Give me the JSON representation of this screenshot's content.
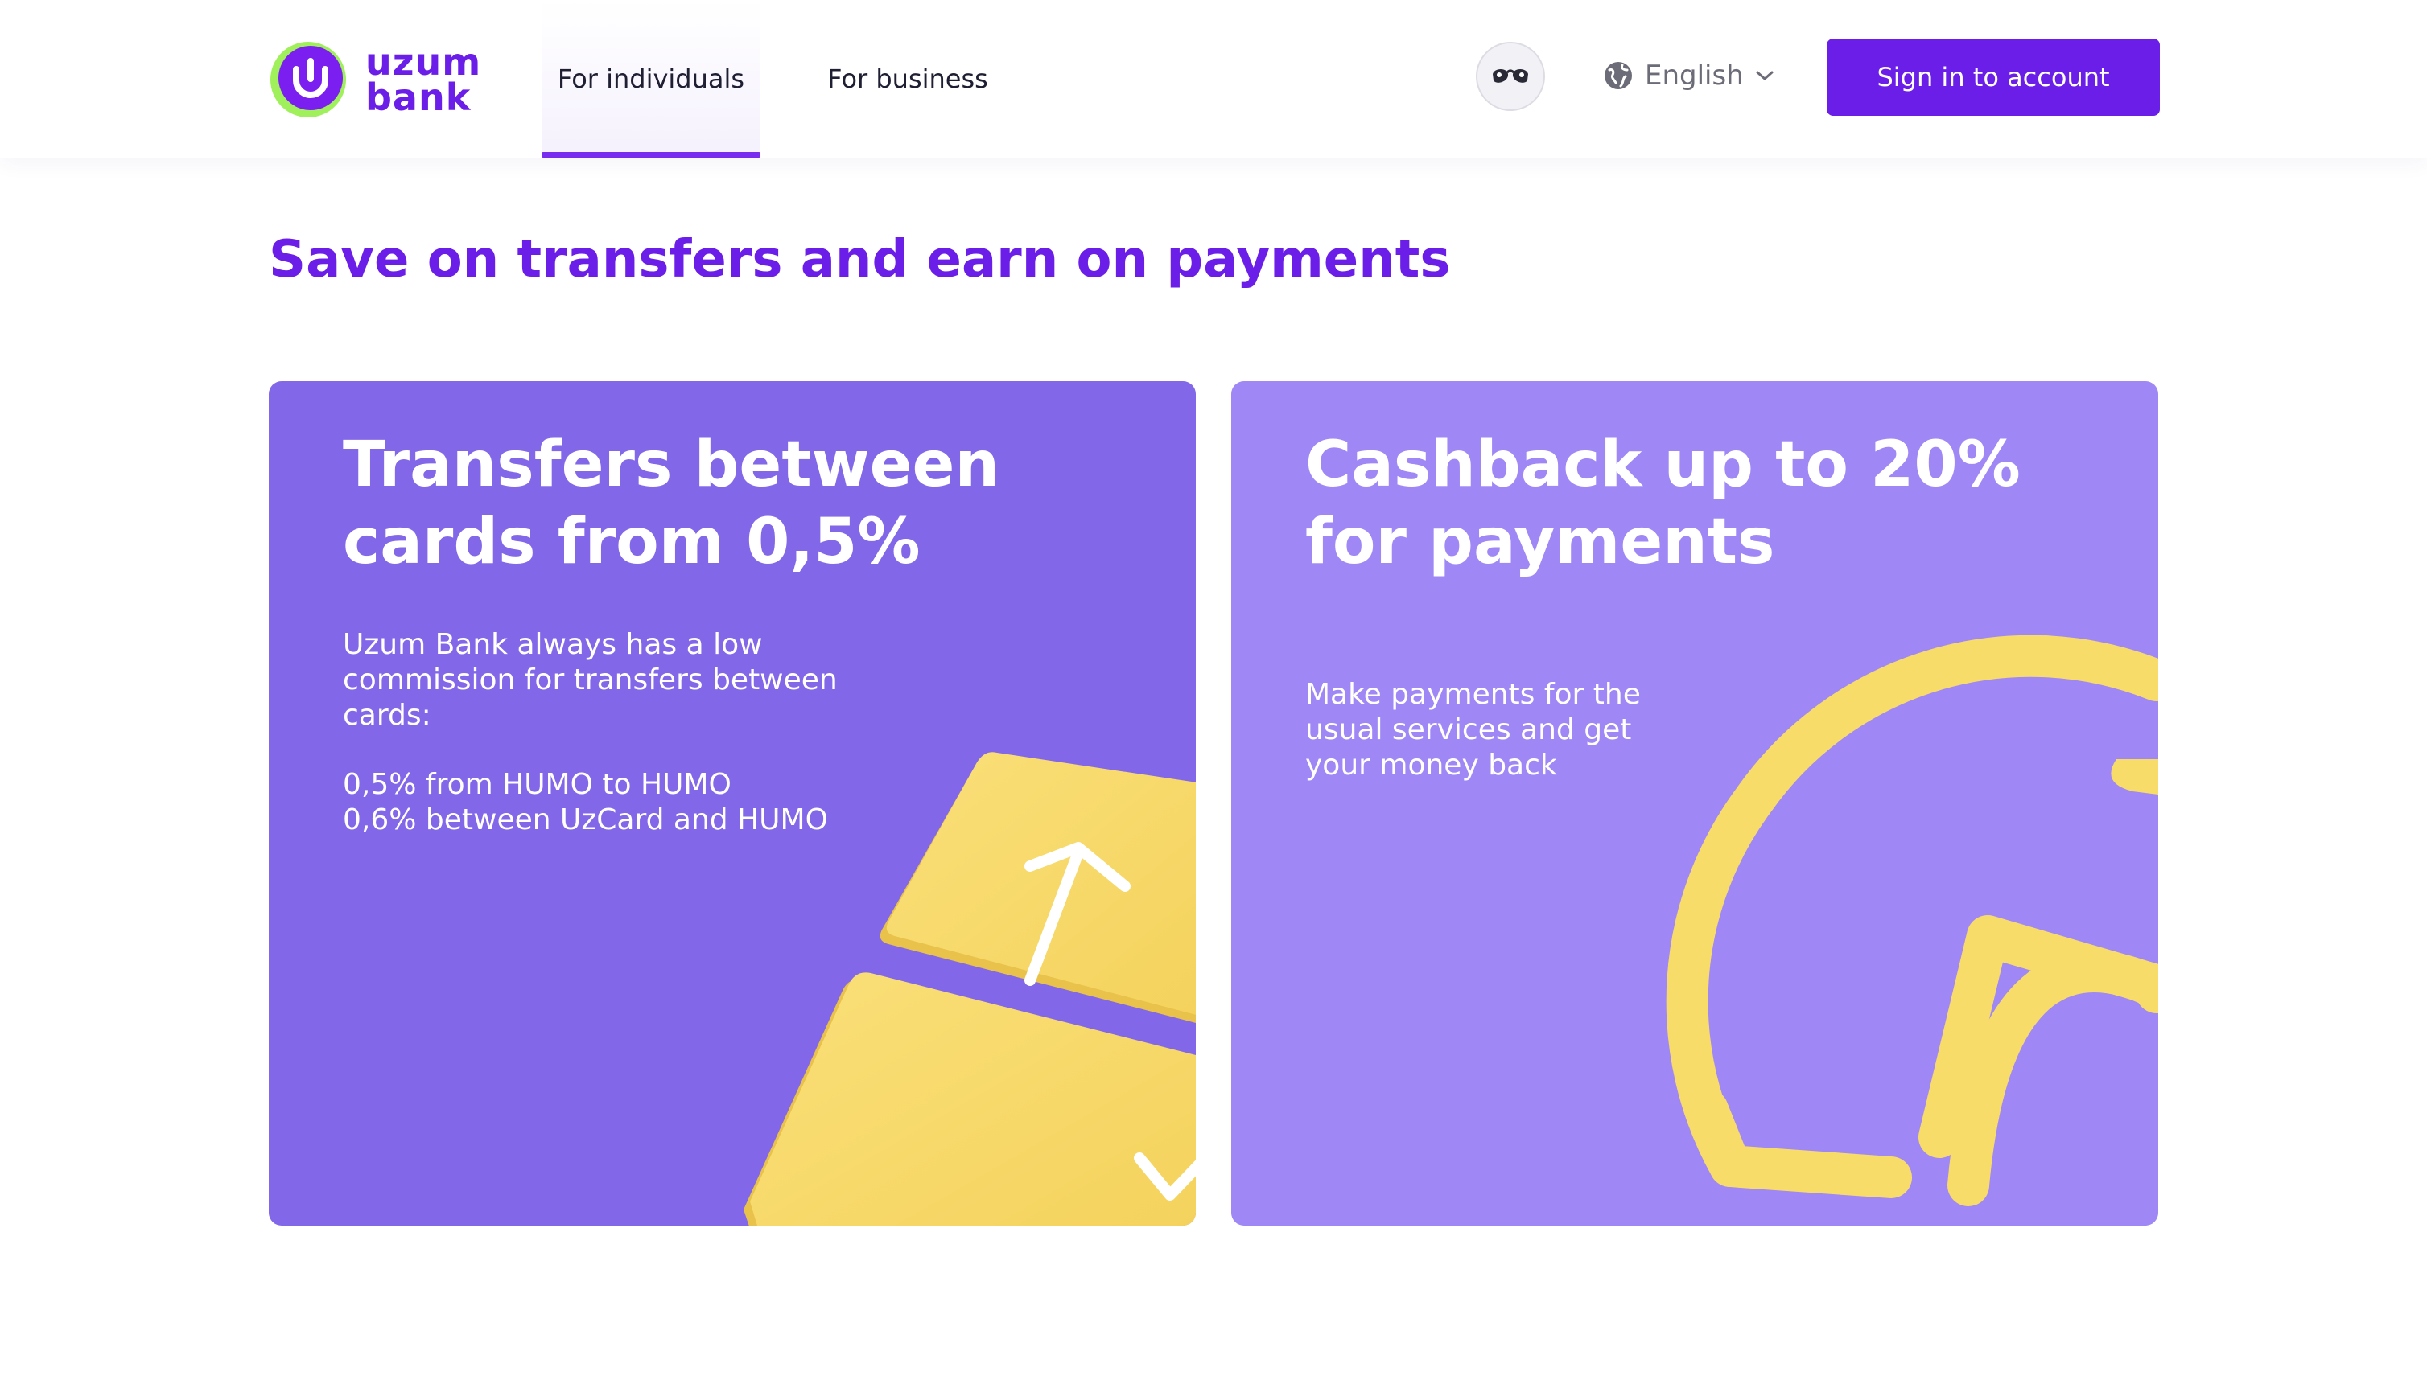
{
  "header": {
    "logo_line1": "uzum",
    "logo_line2": "bank",
    "nav": [
      {
        "label": "For individuals",
        "active": true
      },
      {
        "label": "For business",
        "active": false
      }
    ],
    "language": "English",
    "signin_label": "Sign in to account"
  },
  "hero": {
    "title": "Save on transfers and earn on payments"
  },
  "cards": [
    {
      "title": "Transfers between cards from 0,5%",
      "description": "Uzum Bank always has a low commission for transfers between cards:",
      "rates": [
        "0,5% from HUMO to HUMO",
        "0,6% between UzCard and HUMO"
      ]
    },
    {
      "title": "Cashback up to 20% for payments",
      "description": "Make payments for the usual services and get your money back"
    }
  ],
  "colors": {
    "brand": "#6b1ee8",
    "logo_accent": "#9ff05a",
    "card_left_bg": "#8267e8",
    "card_right_bg": "#9f87f5",
    "illustration": "#f8dc6a"
  },
  "icons": [
    "uzum-logo-icon",
    "glasses-icon",
    "globe-icon",
    "chevron-down-icon"
  ]
}
